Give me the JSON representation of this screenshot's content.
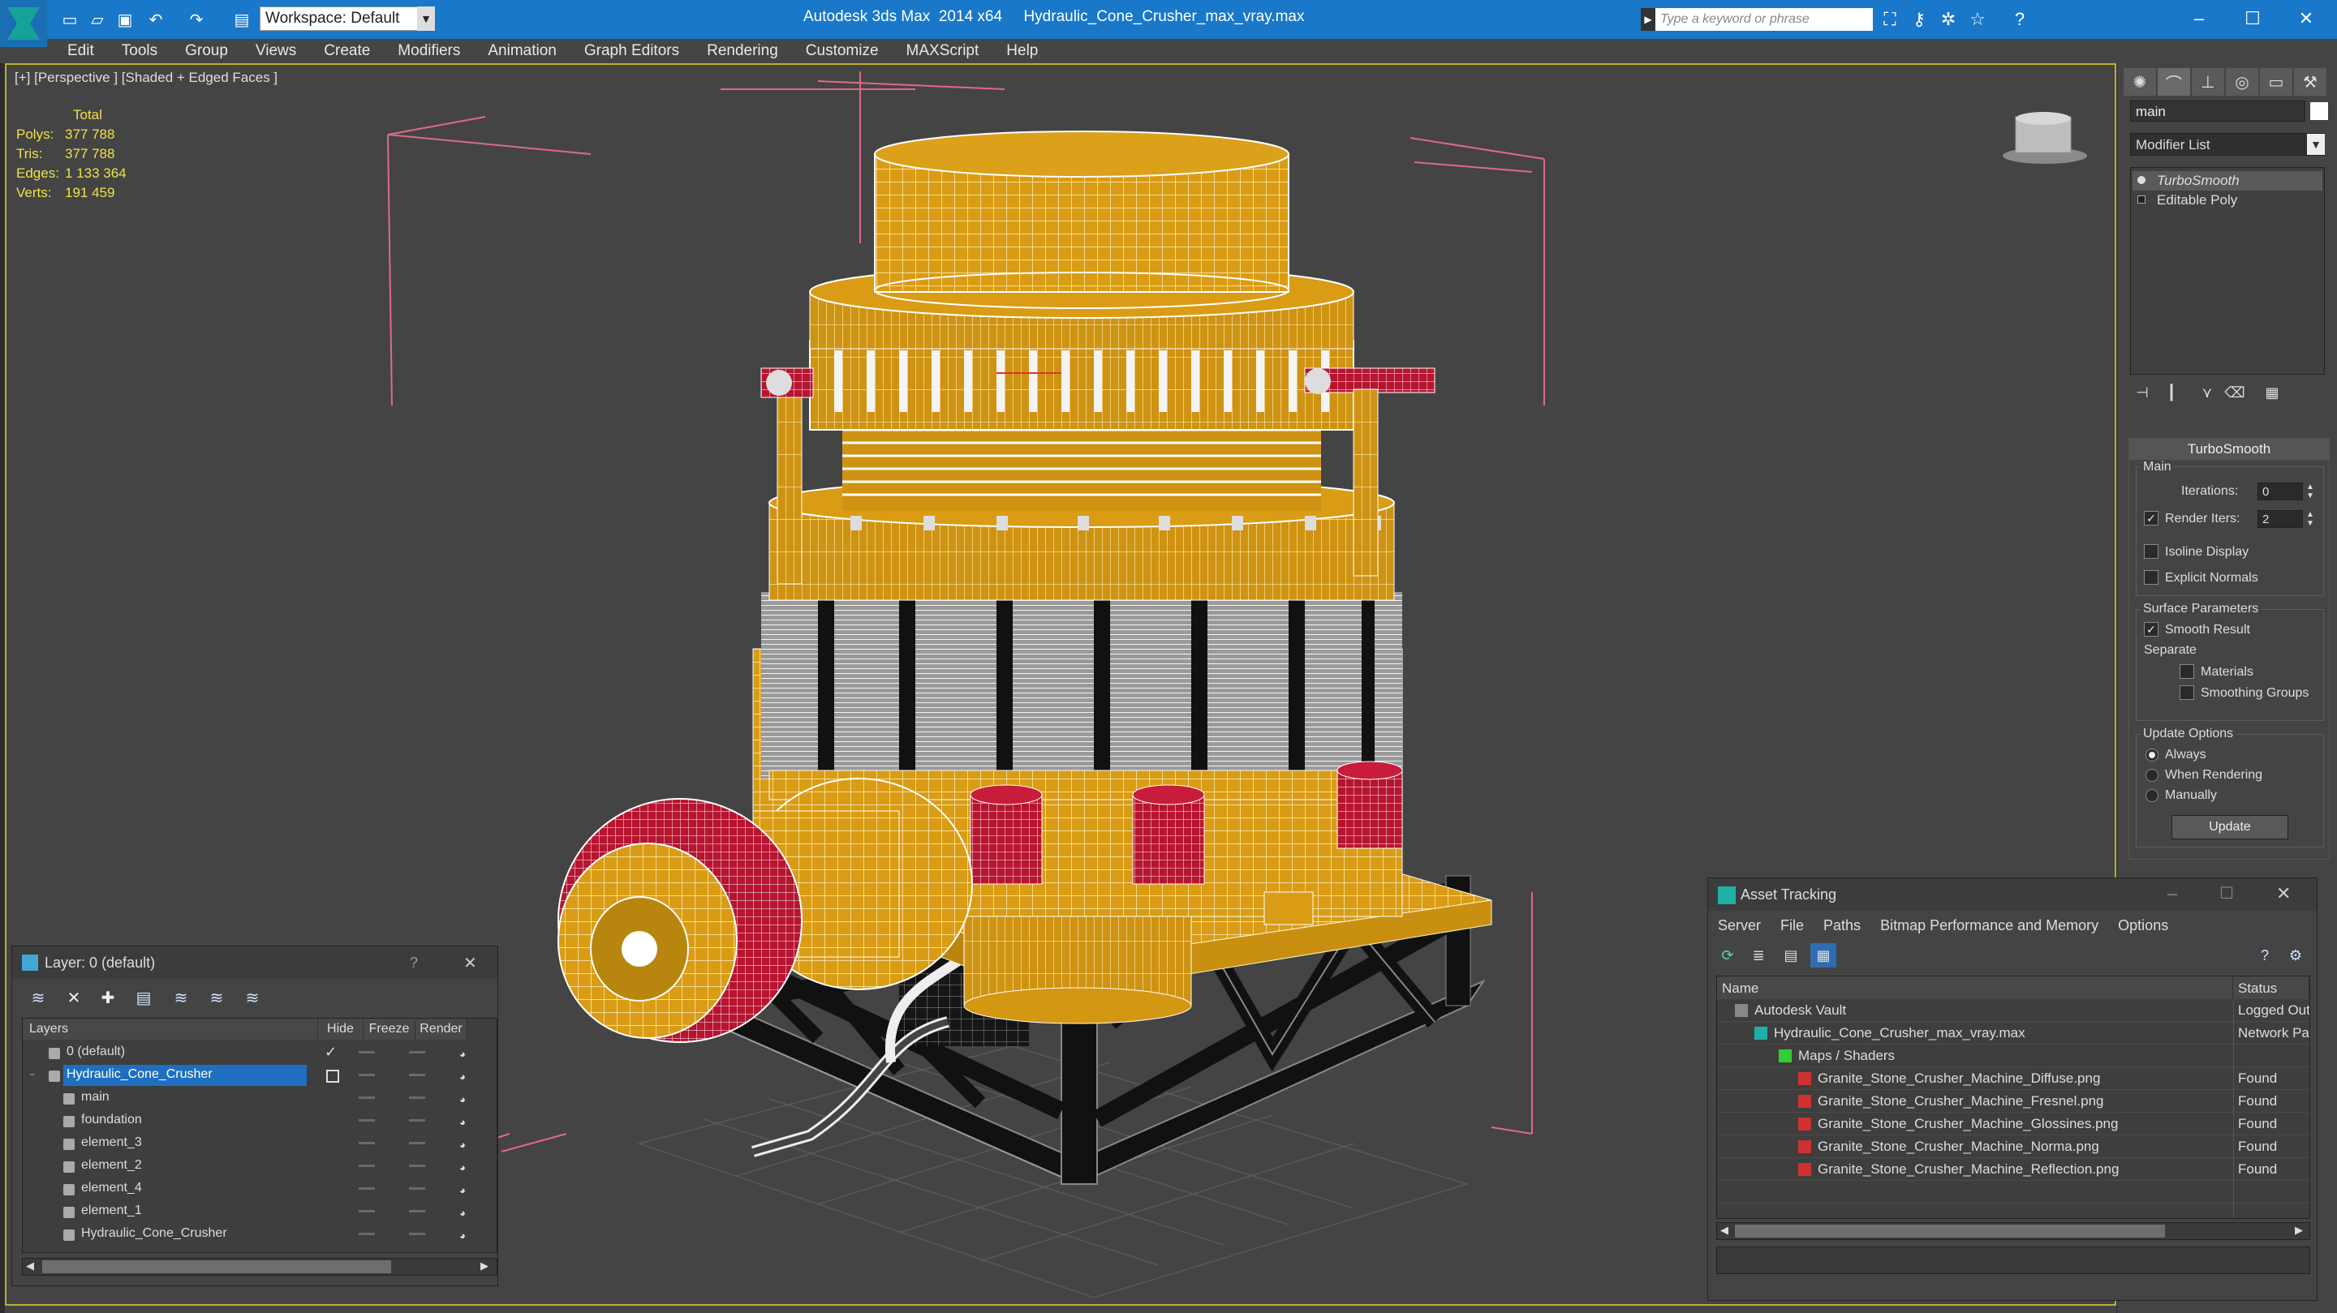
{
  "titlebar": {
    "workspace": "Workspace: Default",
    "app_title": "Autodesk 3ds Max  2014 x64",
    "file_title": "Hydraulic_Cone_Crusher_max_vray.max",
    "search_placeholder": "Type a keyword or phrase"
  },
  "menu": [
    "Edit",
    "Tools",
    "Group",
    "Views",
    "Create",
    "Modifiers",
    "Animation",
    "Graph Editors",
    "Rendering",
    "Customize",
    "MAXScript",
    "Help"
  ],
  "viewport": {
    "label": "[+] [Perspective ] [Shaded + Edged Faces ]",
    "stats": {
      "total_label": "Total",
      "polys_label": "Polys:",
      "polys": "377 788",
      "tris_label": "Tris:",
      "tris": "377 788",
      "edges_label": "Edges:",
      "edges": "1 133 364",
      "verts_label": "Verts:",
      "verts": "191 459"
    }
  },
  "command_panel": {
    "object_name": "main",
    "modifier_list": "Modifier List",
    "stack": [
      "TurboSmooth",
      "Editable Poly"
    ],
    "turbosmooth": {
      "header": "TurboSmooth",
      "main_group": "Main",
      "iterations_label": "Iterations:",
      "iterations": "0",
      "render_iters_label": "Render Iters:",
      "render_iters": "2",
      "render_iters_checked": true,
      "isoline_label": "Isoline Display",
      "explicit_normals_label": "Explicit Normals",
      "surface_group": "Surface Parameters",
      "smooth_result_label": "Smooth Result",
      "separate_label": "Separate",
      "materials_label": "Materials",
      "smoothing_groups_label": "Smoothing Groups",
      "update_group": "Update Options",
      "always_label": "Always",
      "when_rendering_label": "When Rendering",
      "manually_label": "Manually",
      "update_button": "Update"
    }
  },
  "layer_panel": {
    "title": "Layer: 0 (default)",
    "help": "?",
    "columns": [
      "Layers",
      "Hide",
      "Freeze",
      "Render"
    ],
    "rows": [
      {
        "name": "0 (default)",
        "indent": 0
      },
      {
        "name": "Hydraulic_Cone_Crusher",
        "indent": 0
      },
      {
        "name": "main",
        "indent": 1
      },
      {
        "name": "foundation",
        "indent": 1
      },
      {
        "name": "element_3",
        "indent": 1
      },
      {
        "name": "element_2",
        "indent": 1
      },
      {
        "name": "element_4",
        "indent": 1
      },
      {
        "name": "element_1",
        "indent": 1
      },
      {
        "name": "Hydraulic_Cone_Crusher",
        "indent": 1
      }
    ]
  },
  "asset_panel": {
    "title": "Asset Tracking",
    "menu": [
      "Server",
      "File",
      "Paths",
      "Bitmap Performance and Memory",
      "Options"
    ],
    "columns": [
      "Name",
      "Status"
    ],
    "rows": [
      {
        "name": "Autodesk Vault",
        "status": "Logged Out"
      },
      {
        "name": "Hydraulic_Cone_Crusher_max_vray.max",
        "status": "Network Pat"
      },
      {
        "name": "Maps / Shaders",
        "status": ""
      },
      {
        "name": "Granite_Stone_Crusher_Machine_Diffuse.png",
        "status": "Found"
      },
      {
        "name": "Granite_Stone_Crusher_Machine_Fresnel.png",
        "status": "Found"
      },
      {
        "name": "Granite_Stone_Crusher_Machine_Glossines.png",
        "status": "Found"
      },
      {
        "name": "Granite_Stone_Crusher_Machine_Norma.png",
        "status": "Found"
      },
      {
        "name": "Granite_Stone_Crusher_Machine_Reflection.png",
        "status": "Found"
      }
    ]
  },
  "colors": {
    "titlebar": "#1978c9",
    "model_yellow": "#d79b16",
    "model_red": "#b5122f",
    "stats_text": "#f2e14a",
    "selection": "#1f6fc1"
  }
}
